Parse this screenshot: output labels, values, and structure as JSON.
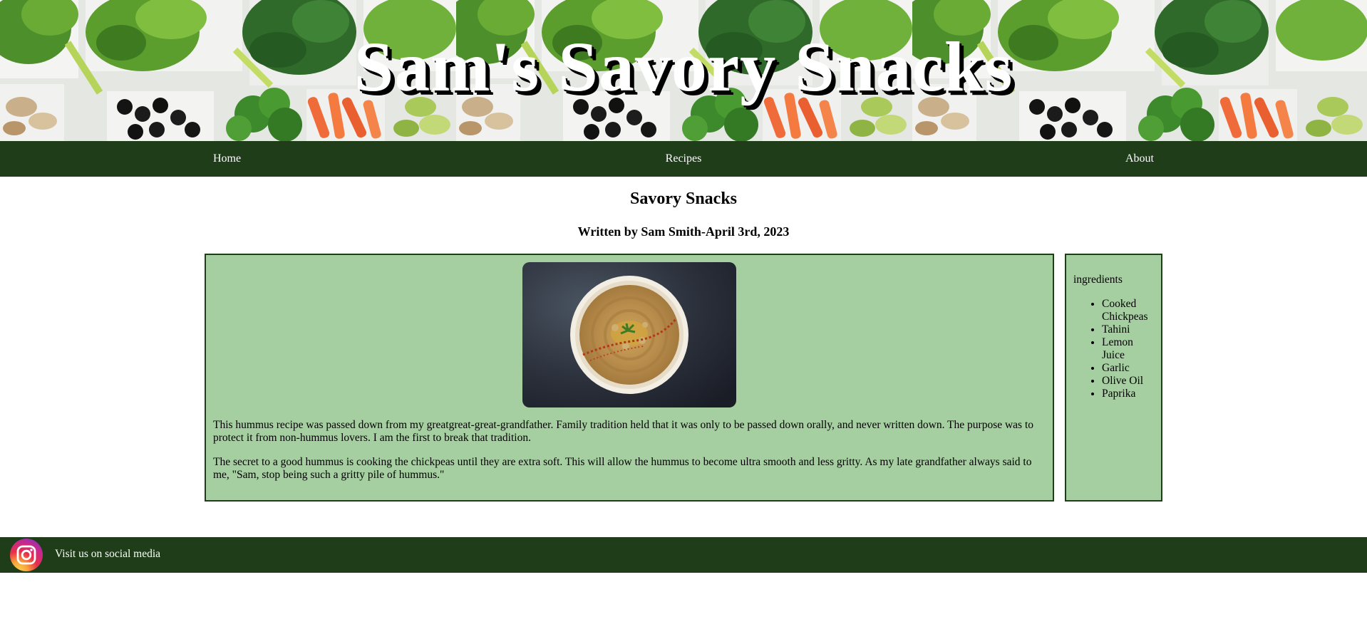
{
  "header": {
    "site_title": "Sam's Savory Snacks"
  },
  "nav": {
    "items": [
      {
        "label": "Home"
      },
      {
        "label": "Recipes"
      },
      {
        "label": "About"
      }
    ]
  },
  "main": {
    "heading": "Savory Snacks",
    "byline": "Written by Sam Smith-April 3rd, 2023",
    "image_icon": "hummus-bowl-photo",
    "paragraphs": [
      "This hummus recipe was passed down from my greatgreat-great-grandfather. Family tradition held that it was only to be passed down orally, and never written down. The purpose was to protect it from non-hummus lovers. I am the first to break that tradition.",
      "The secret to a good hummus is cooking the chickpeas until they are extra soft. This will allow the hummus to become ultra smooth and less gritty. As my late grandfather always said to me, \"Sam, stop being such a gritty pile of hummus.\""
    ]
  },
  "sidebar": {
    "title": "ingredients",
    "items": [
      "Cooked Chickpeas",
      "Tahini",
      "Lemon Juice",
      "Garlic",
      "Olive Oil",
      "Paprika"
    ]
  },
  "footer": {
    "icon": "instagram-icon",
    "text": "Visit us on social media"
  },
  "colors": {
    "nav_bg": "#1e3d18",
    "panel_bg": "#a6cfa1",
    "panel_border": "#1e3d18",
    "text_light": "#ffffff"
  }
}
